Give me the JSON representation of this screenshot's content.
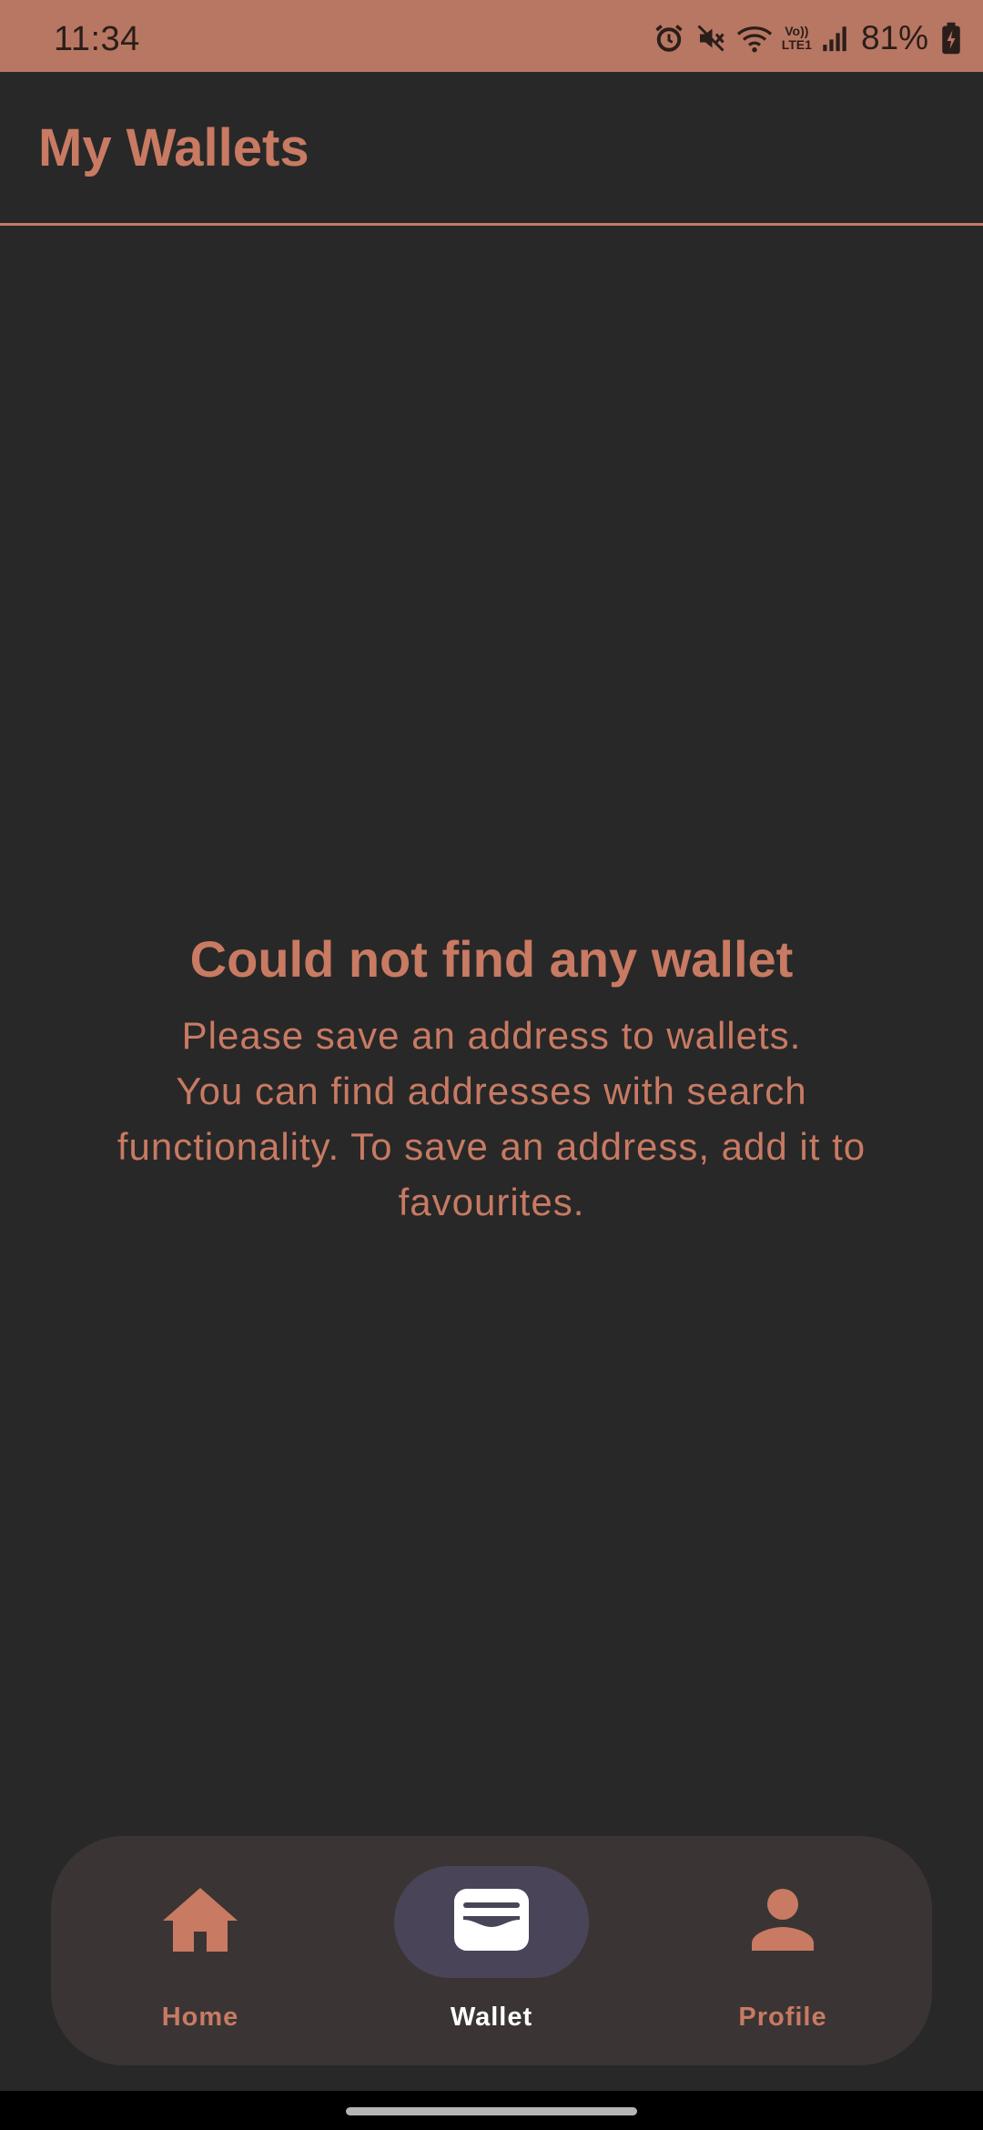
{
  "status_bar": {
    "time": "11:34",
    "volte_line1": "Vo))",
    "volte_line2": "LTE1",
    "battery": "81%",
    "icons": [
      "alarm-icon",
      "mute-icon",
      "wifi-icon",
      "volte-icon",
      "signal-icon",
      "battery-charging-icon"
    ]
  },
  "header": {
    "title": "My Wallets"
  },
  "empty_state": {
    "title": "Could not find any wallet",
    "lines": [
      "Please save an address to wallets.",
      "You can find addresses with search",
      "functionality. To save an address, add it to",
      "favourites."
    ]
  },
  "bottom_nav": {
    "items": [
      {
        "label": "Home",
        "icon": "home-icon",
        "active": false
      },
      {
        "label": "Wallet",
        "icon": "wallet-icon",
        "active": true
      },
      {
        "label": "Profile",
        "icon": "person-icon",
        "active": false
      }
    ]
  },
  "colors": {
    "accent": "#c87a63",
    "status_bar": "#b87763",
    "background": "#282828",
    "nav_background": "#3a3534",
    "active_pill": "#4a4458"
  }
}
